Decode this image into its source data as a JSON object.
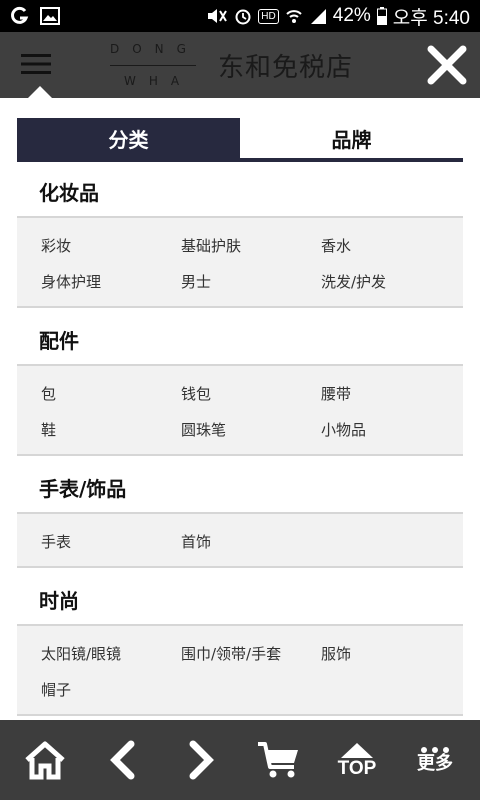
{
  "status_bar": {
    "battery": "42%",
    "time": "오후 5:40",
    "network": "HD"
  },
  "header": {
    "logo_line1": "DONG",
    "logo_line2": "WHA",
    "store_name": "东和免税店"
  },
  "tabs": [
    {
      "label": "分类",
      "active": true
    },
    {
      "label": "品牌",
      "active": false
    }
  ],
  "sections": [
    {
      "title": "化妆品",
      "items": [
        "彩妆",
        "基础护肤",
        "香水",
        "身体护理",
        "男士",
        "洗发/护发"
      ]
    },
    {
      "title": "配件",
      "items": [
        "包",
        "钱包",
        "腰带",
        "鞋",
        "圆珠笔",
        "小物品"
      ]
    },
    {
      "title": "手表/饰品",
      "items": [
        "手表",
        "首饰"
      ]
    },
    {
      "title": "时尚",
      "items": [
        "太阳镜/眼镜",
        "围巾/领带/手套",
        "服饰",
        "帽子"
      ]
    }
  ],
  "bottom_bar": {
    "top_label": "TOP",
    "more_label": "更多"
  },
  "colors": {
    "header_bg": "#3f3f3f",
    "tab_active": "#27293f",
    "bottom_bg": "#3d3d3d"
  }
}
